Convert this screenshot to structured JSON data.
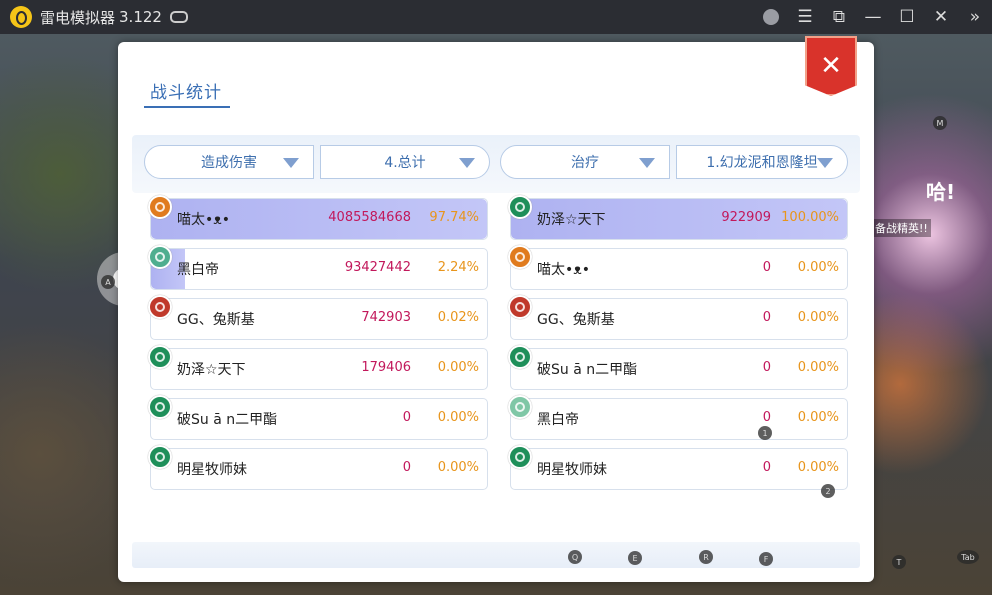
{
  "titlebar": {
    "app_name": "雷电模拟器",
    "version": "3.122"
  },
  "game_overlay": {
    "elite_tag": "备战精英!!",
    "ha_text": "哈!"
  },
  "panel": {
    "tab_title": "战斗统计",
    "close_label": "✕",
    "filters": [
      {
        "label": "造成伤害"
      },
      {
        "label": "4.总计"
      },
      {
        "label": "治疗"
      },
      {
        "label": "1.幻龙泥和恩隆坦"
      }
    ],
    "left_rows": [
      {
        "name": "喵太•ᴥ•",
        "value": "4085584668",
        "percent": "97.74%",
        "fill": 1.0,
        "badge_color": "#e07b1e"
      },
      {
        "name": "黑白帝",
        "value": "93427442",
        "percent": "2.24%",
        "fill": 0.0224,
        "badge_color": "#4fae8f"
      },
      {
        "name": "GG、兔斯基",
        "value": "742903",
        "percent": "0.02%",
        "fill": 0.0,
        "badge_color": "#c0392b"
      },
      {
        "name": "奶泽☆天下",
        "value": "179406",
        "percent": "0.00%",
        "fill": 0.0,
        "badge_color": "#1e8f5a"
      },
      {
        "name": "破Su ā n二甲酯",
        "value": "0",
        "percent": "0.00%",
        "fill": 0.0,
        "badge_color": "#1e8f5a"
      },
      {
        "name": "明星牧师妹",
        "value": "0",
        "percent": "0.00%",
        "fill": 0.0,
        "badge_color": "#1e8f5a"
      }
    ],
    "right_rows": [
      {
        "name": "奶泽☆天下",
        "value": "922909",
        "percent": "100.00%",
        "fill": 1.0,
        "badge_color": "#1e8f5a"
      },
      {
        "name": "喵太•ᴥ•",
        "value": "0",
        "percent": "0.00%",
        "fill": 0.0,
        "badge_color": "#e07b1e"
      },
      {
        "name": "GG、兔斯基",
        "value": "0",
        "percent": "0.00%",
        "fill": 0.0,
        "badge_color": "#c0392b"
      },
      {
        "name": "破Su ā n二甲酯",
        "value": "0",
        "percent": "0.00%",
        "fill": 0.0,
        "badge_color": "#1e8f5a"
      },
      {
        "name": "黑白帝",
        "value": "0",
        "percent": "0.00%",
        "fill": 0.0,
        "badge_color": "#7fc7a6"
      },
      {
        "name": "明星牧师妹",
        "value": "0",
        "percent": "0.00%",
        "fill": 0.0,
        "badge_color": "#1e8f5a"
      }
    ]
  },
  "key_hints": {
    "q": "Q",
    "e": "E",
    "r": "R",
    "f": "F",
    "m": "M",
    "t": "T",
    "tab": "Tab",
    "one": "1",
    "two": "2",
    "a": "A"
  }
}
